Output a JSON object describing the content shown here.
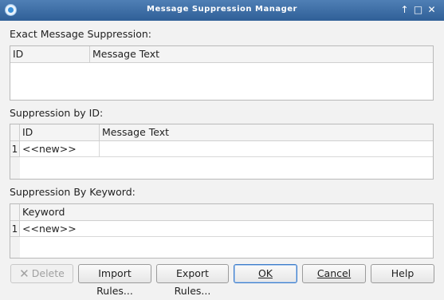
{
  "window": {
    "title": "Message Suppression Manager",
    "controls": [
      "↑",
      "□",
      "✕"
    ]
  },
  "exact": {
    "label": "Exact Message Suppression:",
    "columns": [
      "ID",
      "Message Text"
    ]
  },
  "by_id": {
    "label": "Suppression by ID:",
    "columns": [
      "ID",
      "Message Text"
    ],
    "rows": [
      {
        "num": "1",
        "id": "<<new>>",
        "text": ""
      }
    ]
  },
  "by_keyword": {
    "label": "Suppression By Keyword:",
    "columns": [
      "Keyword"
    ],
    "rows": [
      {
        "num": "1",
        "keyword": "<<new>>"
      }
    ]
  },
  "buttons": {
    "delete": "Delete",
    "import": "Import Rules...",
    "export": "Export Rules...",
    "ok": "OK",
    "cancel": "Cancel",
    "help": "Help"
  }
}
